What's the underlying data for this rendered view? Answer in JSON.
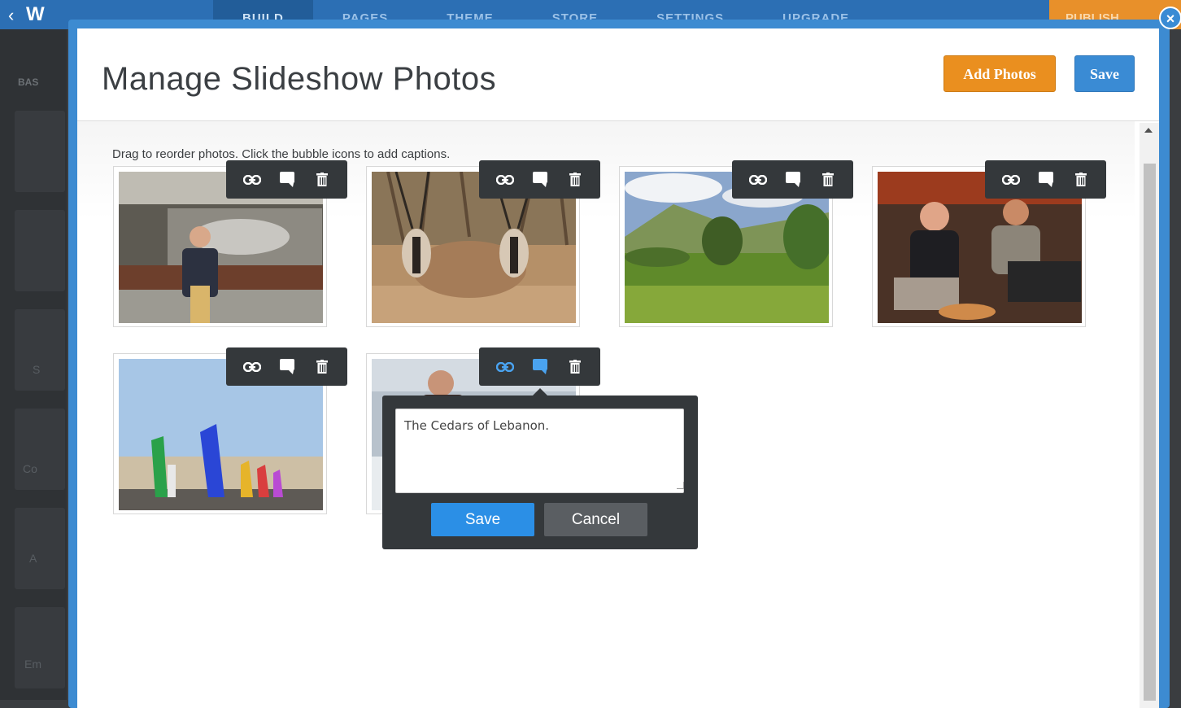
{
  "background": {
    "nav": [
      "BUILD",
      "PAGES",
      "THEME",
      "STORE",
      "SETTINGS",
      "UPGRADE"
    ],
    "publish_label": "PUBLISH",
    "sidebar_label": "BAS",
    "sidebar_tiles": [
      "S",
      "Co",
      "A",
      "Em"
    ]
  },
  "modal": {
    "title": "Manage Slideshow Photos",
    "add_photos_label": "Add Photos",
    "save_label": "Save",
    "close_label": "×",
    "instructions": "Drag to reorder photos. Click the bubble icons to add captions."
  },
  "photos": [
    {
      "name": "museum-man",
      "icons": [
        "link-icon",
        "caption-bubble-icon",
        "trash-icon"
      ]
    },
    {
      "name": "oryx-antelopes",
      "icons": [
        "link-icon",
        "caption-bubble-icon",
        "trash-icon"
      ]
    },
    {
      "name": "green-valley",
      "icons": [
        "link-icon",
        "caption-bubble-icon",
        "trash-icon"
      ]
    },
    {
      "name": "two-men-sitting",
      "icons": [
        "link-icon",
        "caption-bubble-icon",
        "trash-icon"
      ]
    },
    {
      "name": "kites-festival",
      "icons": [
        "link-icon",
        "caption-bubble-icon",
        "trash-icon"
      ]
    },
    {
      "name": "man-in-snow",
      "icons": [
        "link-icon",
        "caption-bubble-icon",
        "trash-icon"
      ],
      "caption_active": true
    }
  ],
  "caption_popup": {
    "text": "The Cedars of Lebanon.",
    "save_label": "Save",
    "cancel_label": "Cancel"
  },
  "colors": {
    "accent_blue": "#3a8bd4",
    "add_orange": "#ea8f1f",
    "toolbar_dark": "#34383b",
    "active_icon": "#4aa3f0"
  }
}
